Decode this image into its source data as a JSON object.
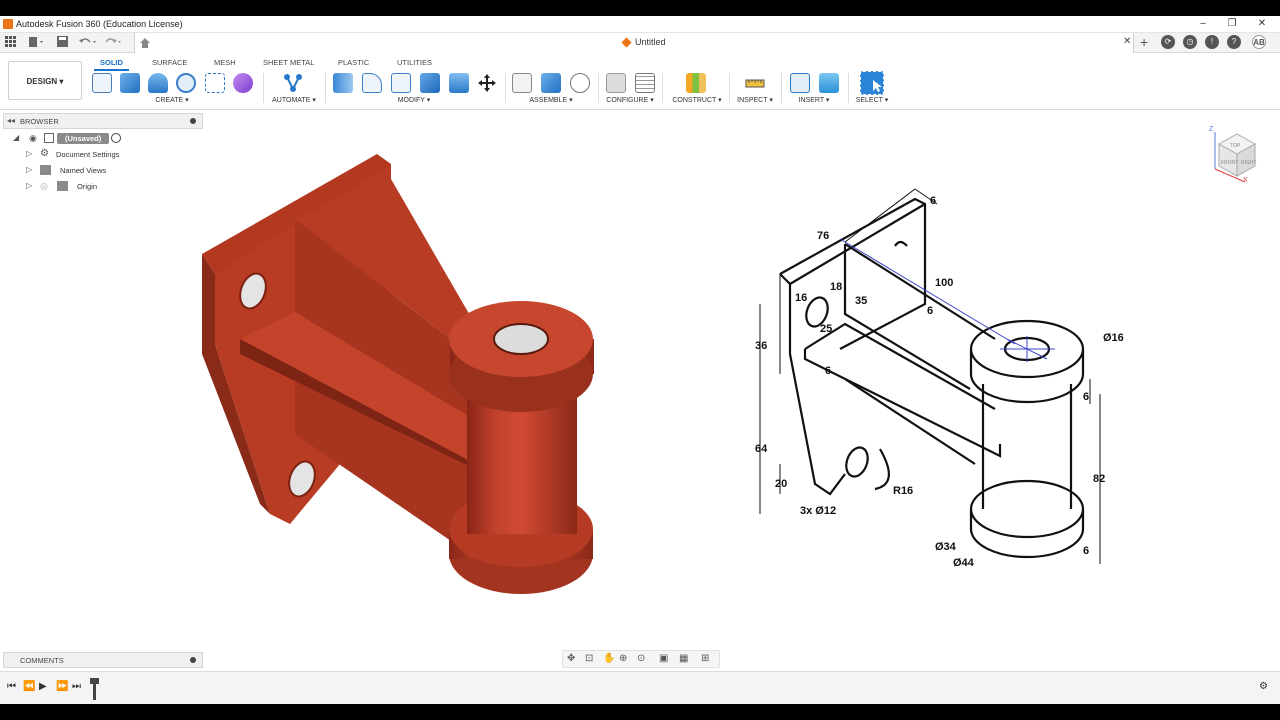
{
  "window": {
    "title": "Autodesk Fusion 360 (Education License)",
    "controls": [
      "–",
      "❐",
      "✕"
    ]
  },
  "tabbar": {
    "document_title": "Untitled",
    "close_glyph": "✕",
    "add_glyph": "+",
    "user_initials": "AB",
    "right_icons": [
      "refresh-icon",
      "clock-icon",
      "bell-icon",
      "help-icon",
      "user-avatar"
    ]
  },
  "ribbon": {
    "workspace_label": "DESIGN ▾",
    "tabs": [
      "SOLID",
      "SURFACE",
      "MESH",
      "SHEET METAL",
      "PLASTIC",
      "UTILITIES"
    ],
    "active_tab": "SOLID",
    "groups": [
      "CREATE ▾",
      "AUTOMATE ▾",
      "MODIFY ▾",
      "ASSEMBLE ▾",
      "CONFIGURE ▾",
      "CONSTRUCT ▾",
      "INSPECT ▾",
      "INSERT ▾",
      "SELECT ▾"
    ]
  },
  "browser": {
    "header": "BROWSER",
    "root_label": "(Unsaved)",
    "items": [
      {
        "label": "Document Settings",
        "icon": "gear-icon"
      },
      {
        "label": "Named Views",
        "icon": "folder-icon"
      },
      {
        "label": "Origin",
        "icon": "folder-icon"
      }
    ]
  },
  "comments": {
    "header": "COMMENTS"
  },
  "drawing": {
    "dimensions": [
      "76",
      "6",
      "18",
      "35",
      "16",
      "25",
      "100",
      "6",
      "Ø16",
      "36",
      "6",
      "6",
      "64",
      "82",
      "20",
      "R16",
      "3x Ø12",
      "Ø34",
      "Ø44",
      "6"
    ]
  },
  "viewcube": {
    "faces": [
      "TOP",
      "FRONT",
      "RIGHT"
    ],
    "axes": [
      "Z",
      "X"
    ]
  },
  "colors": {
    "accent": "#1a73c8",
    "model": "#b33a26",
    "app": "#e8751a"
  }
}
